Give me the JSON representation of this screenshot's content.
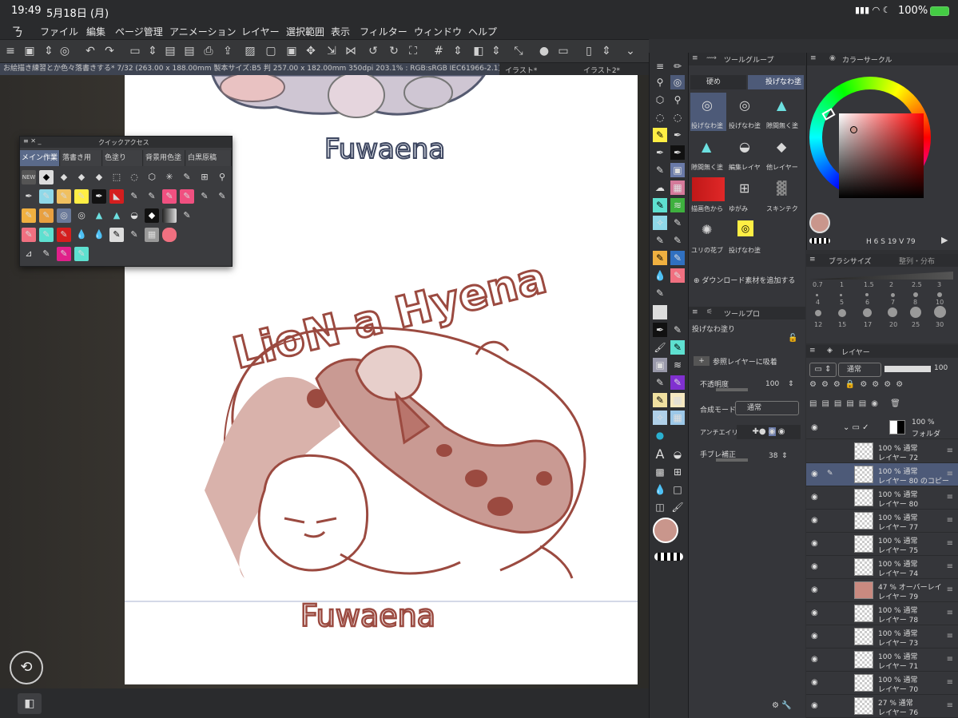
{
  "status": {
    "time": "19:49",
    "date": "5月18日 (月)",
    "battery": "100%"
  },
  "menu": [
    "ファイル",
    "編集",
    "ページ管理",
    "アニメーション",
    "レイヤー",
    "選択範囲",
    "表示",
    "フィルター",
    "ウィンドウ",
    "ヘルプ"
  ],
  "doc_tabs": {
    "active": "お絵描き練習とか色々落書きする* 7/32 (263.00 x 188.00mm 製本サイズ:B5 判 257.00 x 182.00mm 350dpi 203.1% : RGB:sRGB IEC61966-2.1)",
    "tab2": "イラスト*",
    "tab3": "イラスト2*"
  },
  "quick_access": {
    "title": "クイックアクセス",
    "tabs": [
      "メイン作業",
      "落書き用",
      "色塗り",
      "背景用色塗",
      "白黒原稿"
    ]
  },
  "sub_tool": {
    "header": "ツールグループ",
    "groups": [
      "硬め",
      "投げなわ塗"
    ],
    "items": [
      "投げなわ塗",
      "投げなわ塗",
      "隙間無く塗",
      "隙間無く塗",
      "編集レイヤ",
      "他レイヤー",
      "描画色から",
      "ゆがみ",
      "スキンテク",
      "ユリの花ブ",
      "投げなわ塗"
    ],
    "add_material": "ダウンロード素材を追加する"
  },
  "tool_property": {
    "header": "ツールプロ",
    "name": "投げなわ塗り",
    "ref_layer": "参照レイヤーに吸着",
    "opacity_label": "不透明度",
    "opacity_value": "100",
    "blend_label": "合成モード",
    "blend_value": "通常",
    "antialias_label": "アンチエイリ",
    "stabilizer_label": "手ブレ補正",
    "stabilizer_value": "38"
  },
  "color": {
    "header": "カラーサークル",
    "hsv": {
      "h": "6",
      "s": "19",
      "v": "79"
    },
    "main_color": "#c9968c",
    "sub_color": "#ffffff"
  },
  "brush": {
    "header": "ブラシサイズ",
    "header2": "整列・分布",
    "sizes": [
      "0.7",
      "1",
      "1.5",
      "2",
      "2.5",
      "3",
      "4",
      "5",
      "6",
      "7",
      "8",
      "10",
      "12",
      "15",
      "17",
      "20",
      "25",
      "30"
    ]
  },
  "layers": {
    "header": "レイヤー",
    "blend": "通常",
    "opacity": "100",
    "folder": {
      "pct": "100 %",
      "name": "フォルダ"
    },
    "rows": [
      {
        "pct": "100 % 通常",
        "name": "レイヤー 72",
        "sel": false,
        "eye": false
      },
      {
        "pct": "100 % 通常",
        "name": "レイヤー 80 のコピー",
        "sel": true,
        "eye": true
      },
      {
        "pct": "100 % 通常",
        "name": "レイヤー 80",
        "sel": false,
        "eye": true
      },
      {
        "pct": "100 % 通常",
        "name": "レイヤー 77",
        "sel": false,
        "eye": true
      },
      {
        "pct": "100 % 通常",
        "name": "レイヤー 75",
        "sel": false,
        "eye": true
      },
      {
        "pct": "100 % 通常",
        "name": "レイヤー 74",
        "sel": false,
        "eye": true
      },
      {
        "pct": "47 % オーバーレイ",
        "name": "レイヤー 79",
        "sel": false,
        "eye": true
      },
      {
        "pct": "100 % 通常",
        "name": "レイヤー 78",
        "sel": false,
        "eye": true
      },
      {
        "pct": "100 % 通常",
        "name": "レイヤー 73",
        "sel": false,
        "eye": true
      },
      {
        "pct": "100 % 通常",
        "name": "レイヤー 71",
        "sel": false,
        "eye": true
      },
      {
        "pct": "100 % 通常",
        "name": "レイヤー 70",
        "sel": false,
        "eye": true
      },
      {
        "pct": "27 % 通常",
        "name": "レイヤー 76",
        "sel": false,
        "eye": true
      }
    ]
  },
  "artwork": {
    "title": "LioN a Hyena",
    "signature": "Fuwaena",
    "signature_top": "Fuwaena",
    "stroke": "#9b4a40"
  }
}
